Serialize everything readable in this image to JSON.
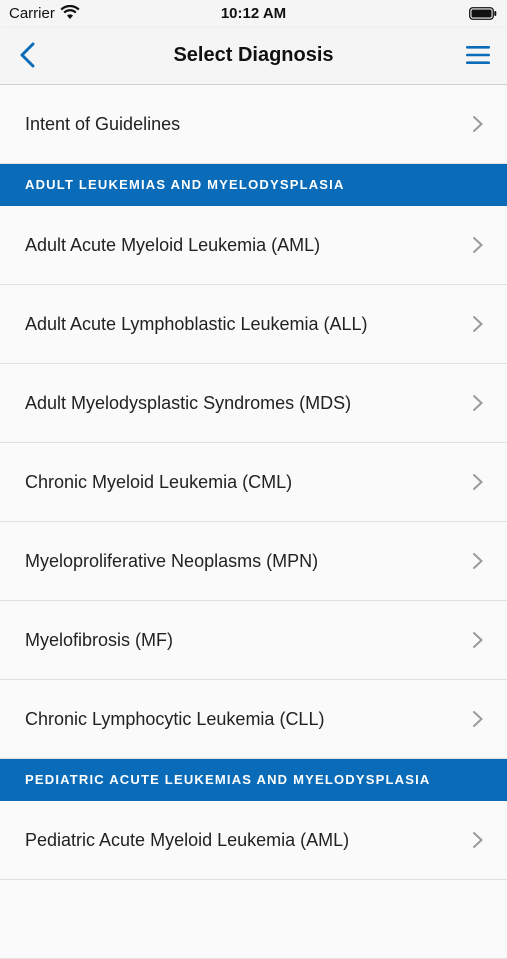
{
  "status_bar": {
    "carrier": "Carrier",
    "time": "10:12 AM"
  },
  "nav": {
    "title": "Select Diagnosis"
  },
  "intro_row": {
    "label": "Intent of Guidelines"
  },
  "sections": [
    {
      "header": "ADULT LEUKEMIAS AND MYELODYSPLASIA",
      "items": [
        "Adult Acute Myeloid Leukemia (AML)",
        "Adult Acute Lymphoblastic Leukemia (ALL)",
        "Adult Myelodysplastic Syndromes (MDS)",
        "Chronic Myeloid Leukemia (CML)",
        "Myeloproliferative Neoplasms (MPN)",
        "Myelofibrosis (MF)",
        "Chronic Lymphocytic Leukemia (CLL)"
      ]
    },
    {
      "header": "PEDIATRIC ACUTE LEUKEMIAS AND MYELODYSPLASIA",
      "items": [
        "Pediatric Acute Myeloid Leukemia (AML)",
        ""
      ]
    }
  ],
  "colors": {
    "accent": "#0a6cb8",
    "chevron": "#9a9a9a"
  },
  "icons": {
    "back": "chevron-left-icon",
    "menu": "hamburger-menu-icon",
    "row": "chevron-right-icon"
  }
}
